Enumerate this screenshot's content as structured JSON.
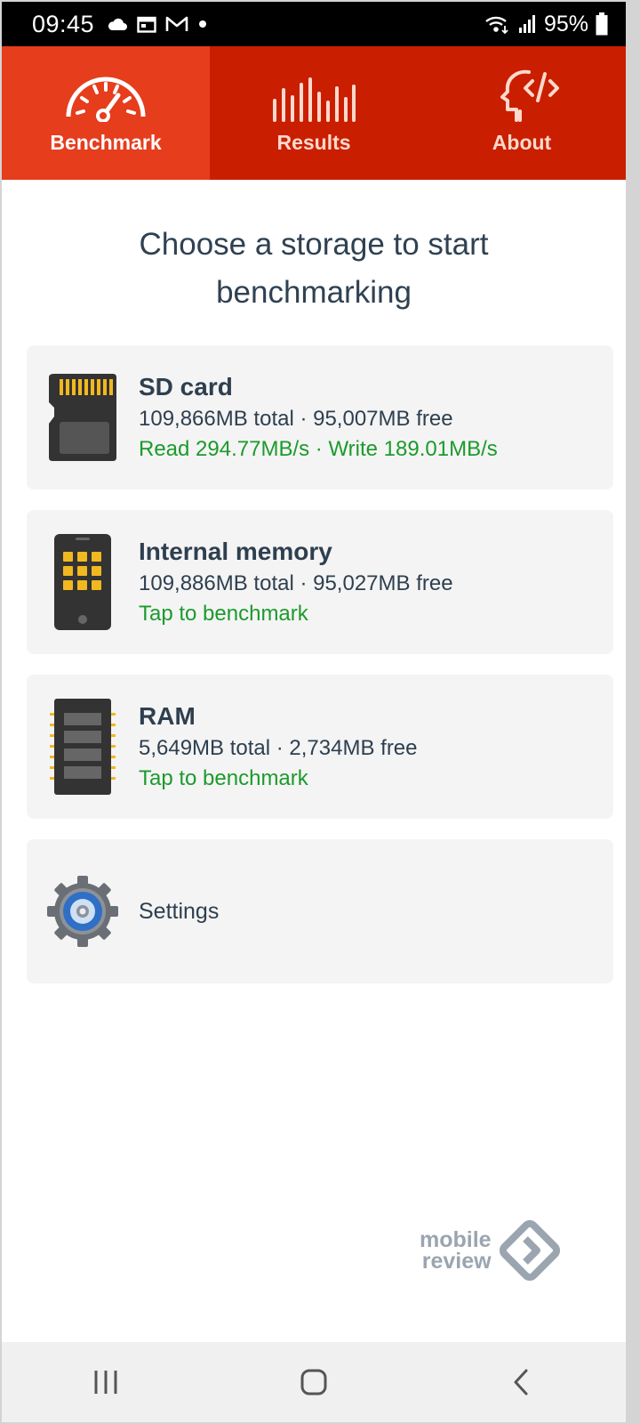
{
  "status_bar": {
    "time": "09:45",
    "battery": "95%",
    "icons": [
      "cloud-icon",
      "calendar-icon",
      "gmail-icon",
      "dot-icon",
      "wifi-icon",
      "signal-icon",
      "battery-icon"
    ]
  },
  "tabs": [
    {
      "label": "Benchmark",
      "icon": "speedometer-icon",
      "active": true
    },
    {
      "label": "Results",
      "icon": "bars-icon",
      "active": false
    },
    {
      "label": "About",
      "icon": "head-code-icon",
      "active": false
    }
  ],
  "heading": {
    "line1": "Choose a storage to start",
    "line2": "benchmarking"
  },
  "storages": [
    {
      "title": "SD card",
      "info": "109,866MB total · 95,007MB free",
      "status": "Read 294.77MB/s · Write 189.01MB/s",
      "icon": "sd-card-icon"
    },
    {
      "title": "Internal memory",
      "info": "109,886MB total · 95,027MB free",
      "status": "Tap to benchmark",
      "icon": "phone-icon"
    },
    {
      "title": "RAM",
      "info": "5,649MB total · 2,734MB free",
      "status": "Tap to benchmark",
      "icon": "ram-chip-icon"
    }
  ],
  "settings": {
    "label": "Settings",
    "icon": "gear-icon"
  },
  "watermark": {
    "line1": "mobile",
    "line2": "review"
  },
  "nav": [
    "recents-icon",
    "home-icon",
    "back-icon"
  ],
  "colors": {
    "tab_bar": "#c91f00",
    "tab_active": "#e63d1d",
    "status_green": "#1c9a2c",
    "card_bg": "#f4f4f4",
    "text_dark": "#2e3f4f"
  }
}
